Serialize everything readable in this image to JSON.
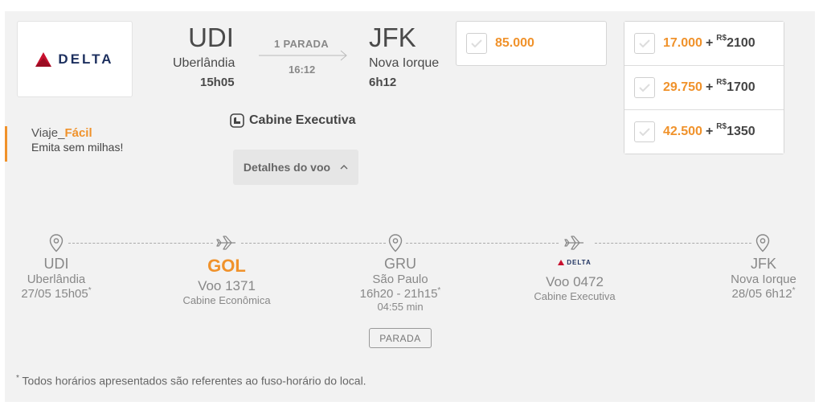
{
  "airline": {
    "name": "DELTA"
  },
  "origin": {
    "code": "UDI",
    "city": "Uberlândia",
    "time": "15h05"
  },
  "route": {
    "stops": "1 PARADA",
    "duration": "16:12"
  },
  "destination": {
    "code": "JFK",
    "city": "Nova Iorque",
    "time": "6h12"
  },
  "cabin": {
    "label": "Cabine Executiva"
  },
  "details_button": {
    "label": "Detalhes do voo"
  },
  "promo": {
    "prefix": "Viaje",
    "separator": "_",
    "accent": "Fácil",
    "subtitle": "Emita sem milhas!"
  },
  "price_options": {
    "miles_only": {
      "miles": "85.000"
    },
    "mixed": [
      {
        "miles": "17.000",
        "plus": "+",
        "currency": "R$",
        "price": "2100"
      },
      {
        "miles": "29.750",
        "plus": "+",
        "currency": "R$",
        "price": "1700"
      },
      {
        "miles": "42.500",
        "plus": "+",
        "currency": "R$",
        "price": "1350"
      }
    ]
  },
  "timeline": {
    "origin": {
      "code": "UDI",
      "city": "Uberlândia",
      "datetime": "27/05 15h05",
      "asterisk": "*"
    },
    "leg1": {
      "airline_logo": "GOL",
      "flight": "Voo 1371",
      "cabin": "Cabine Econômica"
    },
    "connection": {
      "code": "GRU",
      "city": "São Paulo",
      "times": "16h20 - 21h15",
      "asterisk": "*",
      "layover": "04:55 min",
      "tag": "PARADA"
    },
    "leg2": {
      "airline_logo": "DELTA",
      "flight": "Voo 0472",
      "cabin": "Cabine Executiva"
    },
    "destination": {
      "code": "JFK",
      "city": "Nova Iorque",
      "datetime": "28/05 6h12",
      "asterisk": "*"
    }
  },
  "footnote": {
    "asterisk": "*",
    "text": " Todos horários apresentados são referentes ao fuso-horário do local."
  },
  "colors": {
    "accent": "#f0922b",
    "delta_red": "#c8102e",
    "delta_blue": "#1c2f5e",
    "background": "#f2f2f2"
  },
  "icons": [
    "delta-logo-icon",
    "arrow-right-icon",
    "cabin-seat-icon",
    "chevron-up-icon",
    "check-icon",
    "map-pin-icon",
    "airplane-icon",
    "gol-logo-icon"
  ]
}
